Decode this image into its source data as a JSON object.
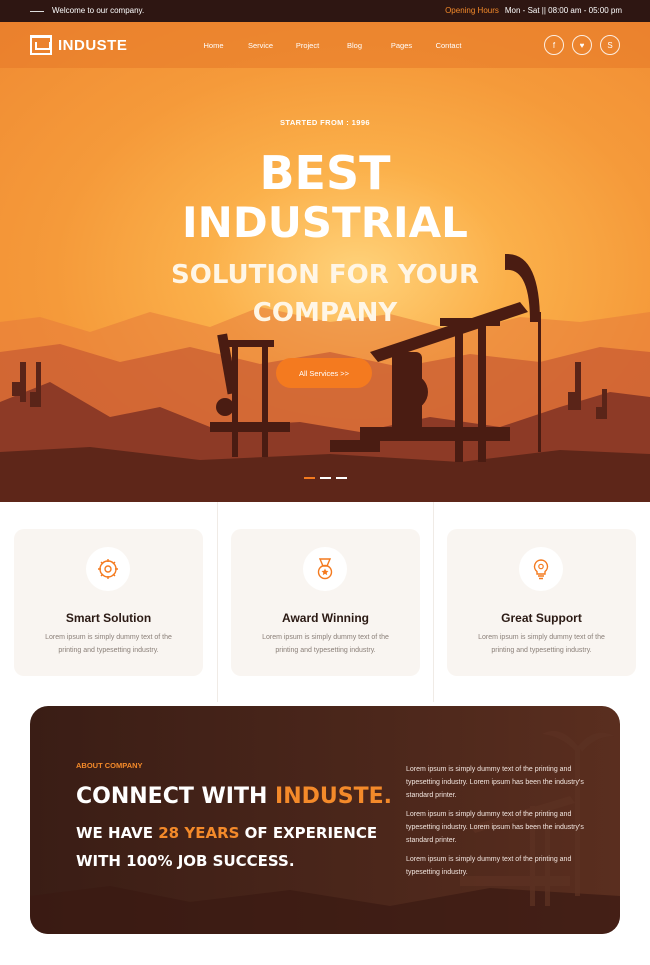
{
  "topbar": {
    "welcome": "Welcome to our company.",
    "hours_label": "Opening Hours",
    "hours_value": "Mon - Sat || 08:00 am - 05:00 pm"
  },
  "nav": {
    "brand": "INDUSTE",
    "items": [
      "Home",
      "Service",
      "Project",
      "Blog",
      "Pages",
      "Contact"
    ],
    "social": [
      {
        "icon": "facebook-icon",
        "glyph": "f"
      },
      {
        "icon": "twitter-icon",
        "glyph": "♥"
      },
      {
        "icon": "skype-icon",
        "glyph": "S"
      }
    ]
  },
  "hero": {
    "since": "STARTED FROM : 1996",
    "title_line1": "BEST",
    "title_line2": "INDUSTRIAL",
    "subtitle_line1": "SOLUTION FOR YOUR",
    "subtitle_line2": "COMPANY",
    "cta_label": "All Services >>",
    "slides": 3,
    "active_slide": 1
  },
  "features": [
    {
      "title": "Smart Solution",
      "desc": "Lorem ipsum is simply dummy text of the printing and typesetting industry.",
      "icon": "gear-brain-icon"
    },
    {
      "title": "Award Winning",
      "desc": "Lorem ipsum is simply dummy text of the printing and typesetting industry.",
      "icon": "medal-icon"
    },
    {
      "title": "Great Support",
      "desc": "Lorem ipsum is simply dummy text of the printing and typesetting industry.",
      "icon": "lightbulb-gear-icon"
    }
  ],
  "about": {
    "label": "ABOUT COMPANY",
    "heading_plain": "CONNECT WITH ",
    "heading_accent": "INDUSTE.",
    "sub1_pre": "WE HAVE ",
    "sub1_accent": "28 YEARS",
    "sub1_post": " OF EXPERIENCE",
    "sub2": "WITH 100% JOB SUCCESS.",
    "paragraphs": [
      "Lorem ipsum is simply dummy text of the printing and typesetting industry. Lorem ipsum has been the industry's standard printer.",
      "Lorem ipsum is simply dummy text of the printing and typesetting industry. Lorem ipsum has been the industry's standard printer.",
      "Lorem ipsum is simply dummy text of the printing and typesetting industry."
    ]
  },
  "colors": {
    "accent": "#f47a1f",
    "dark": "#2e1612",
    "hero_orange": "#f59a3a",
    "card_bg": "#f9f5f1"
  }
}
